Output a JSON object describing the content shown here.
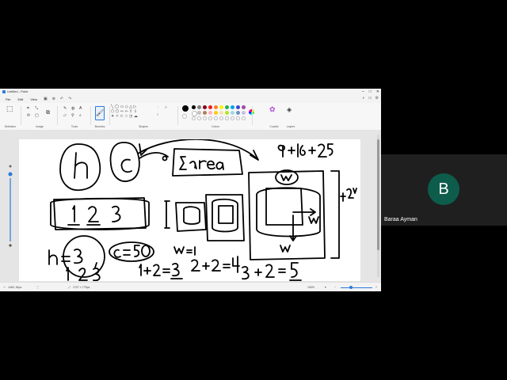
{
  "window": {
    "title": "Untitled - Paint"
  },
  "menu": {
    "file": "File",
    "edit": "Edit",
    "view": "View"
  },
  "ribbon": {
    "groups": {
      "selection": "Selection",
      "image": "Image",
      "tools": "Tools",
      "brushes": "Brushes",
      "shapes": "Shapes",
      "colors": "Colors",
      "copilot": "Copilot",
      "layers": "Layers"
    },
    "palette": [
      "#000000",
      "#7f7f7f",
      "#880015",
      "#ed1c24",
      "#ff7f27",
      "#fff200",
      "#22b14c",
      "#00a2e8",
      "#3f48cc",
      "#a349a4",
      "#ffffff",
      "#c3c3c3",
      "#b97a57",
      "#ffaec9",
      "#ffc90e",
      "#efe4b0",
      "#b5e61d",
      "#99d9ea",
      "#7092be",
      "#c8bfe7"
    ]
  },
  "status": {
    "cursor": "1463, 54px",
    "size": "1727 × 779px",
    "zoom": "100%"
  },
  "meeting": {
    "participant_name": "Baraa Ayman",
    "avatar_initial": "B",
    "avatar_color": "#0d5c4c"
  }
}
